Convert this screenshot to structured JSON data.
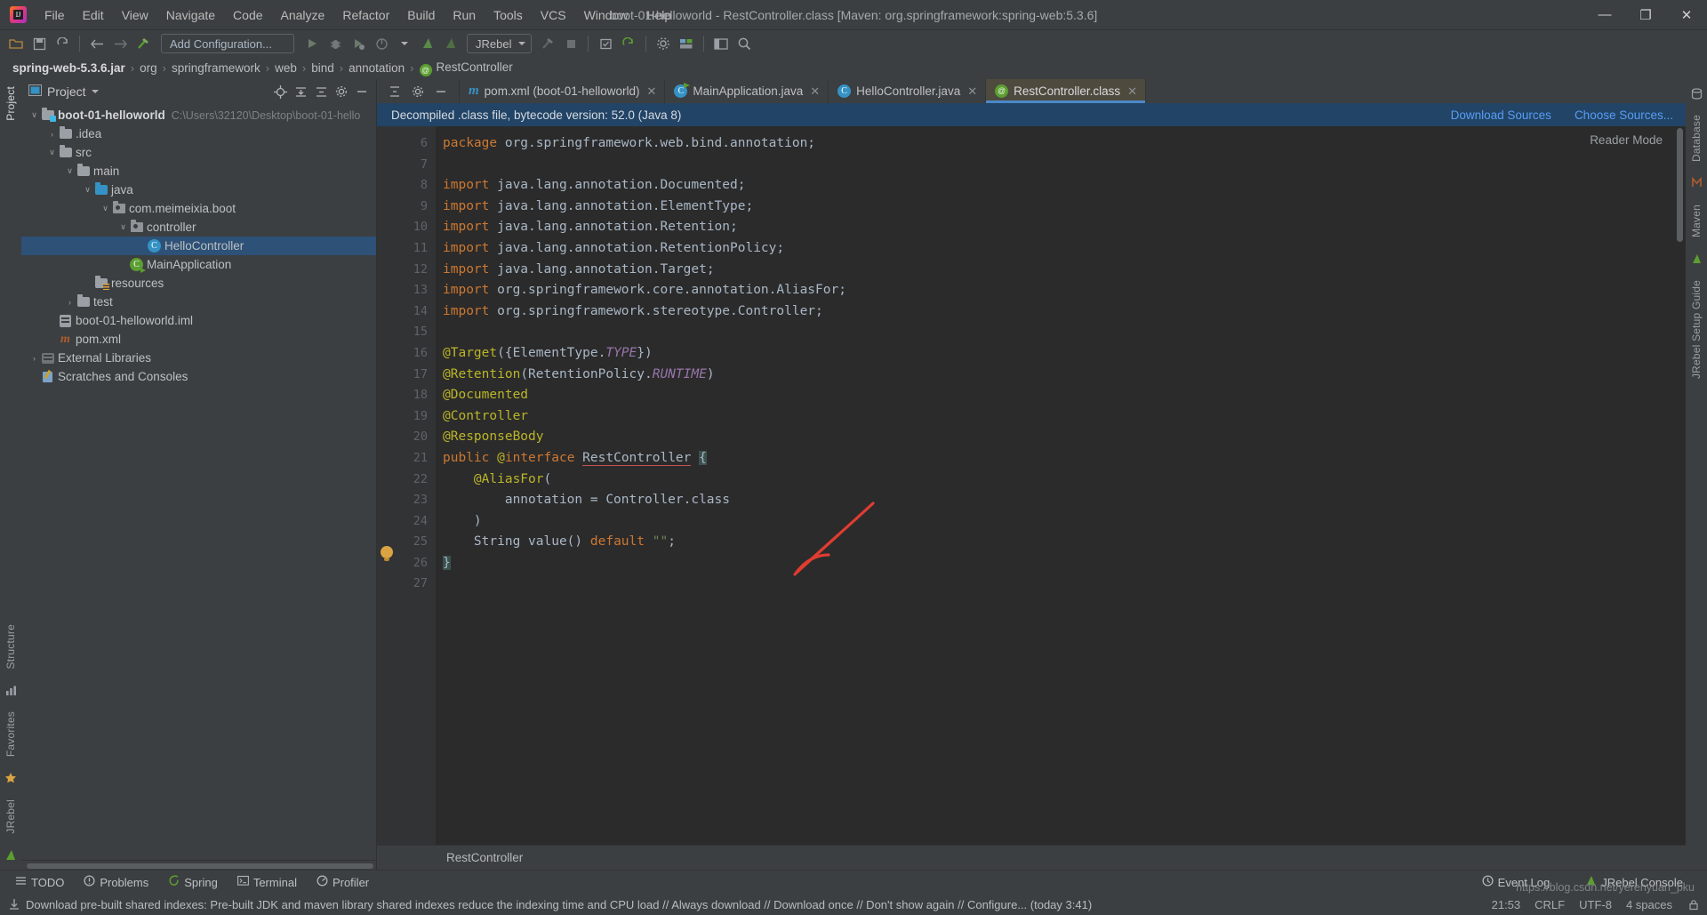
{
  "window": {
    "title": "boot-01-helloworld - RestController.class [Maven: org.springframework:spring-web:5.3.6]",
    "minimize": "—",
    "maximize": "❐",
    "close": "✕"
  },
  "menu": [
    "File",
    "Edit",
    "View",
    "Navigate",
    "Code",
    "Analyze",
    "Refactor",
    "Build",
    "Run",
    "Tools",
    "VCS",
    "Window",
    "Help"
  ],
  "toolbar": {
    "open_icon": "open-folder-icon",
    "save_icon": "save-icon",
    "sync_icon": "sync-icon",
    "back_icon": "back-arrow-icon",
    "forward_icon": "forward-arrow-icon",
    "build_icon": "hammer-icon",
    "run_config": "Add Configuration...",
    "run_icon": "run-icon",
    "debug_icon": "debug-icon",
    "run_coverage_icon": "run-coverage-icon",
    "profile_icon": "profile-icon",
    "jrebel_run_icon": "jrebel-run-icon",
    "jrebel_debug_icon": "jrebel-debug-icon",
    "jrebel_select": "JRebel",
    "stop_icon": "stop-icon",
    "build_project_icon": "build-project-icon",
    "commit_icon": "commit-icon",
    "update_icon": "update-project-icon",
    "settings_icon": "gear-icon",
    "structure_icon": "project-structure-icon",
    "layout_icon": "layout-icon",
    "search_icon": "search-icon"
  },
  "breadcrumb": {
    "items": [
      "spring-web-5.3.6.jar",
      "org",
      "springframework",
      "web",
      "bind",
      "annotation"
    ],
    "leaf": "RestController",
    "separator": "›"
  },
  "project_panel": {
    "title": "Project",
    "dropdown_icon": "chevron-down-icon",
    "actions": [
      "locate-icon",
      "expand-all-icon",
      "collapse-all-icon",
      "settings-icon",
      "hide-icon"
    ],
    "tree": [
      {
        "label": "boot-01-helloworld",
        "path": "C:\\Users\\32120\\Desktop\\boot-01-hello",
        "indent": 0,
        "arrow": "∨",
        "icon": "module-folder",
        "bold": true,
        "selected": false
      },
      {
        "label": ".idea",
        "path": "",
        "indent": 1,
        "arrow": "›",
        "icon": "folder",
        "bold": false,
        "selected": false
      },
      {
        "label": "src",
        "path": "",
        "indent": 1,
        "arrow": "∨",
        "icon": "folder",
        "bold": false,
        "selected": false
      },
      {
        "label": "main",
        "path": "",
        "indent": 2,
        "arrow": "∨",
        "icon": "folder",
        "bold": false,
        "selected": false
      },
      {
        "label": "java",
        "path": "",
        "indent": 3,
        "arrow": "∨",
        "icon": "folder-blue",
        "bold": false,
        "selected": false
      },
      {
        "label": "com.meimeixia.boot",
        "path": "",
        "indent": 4,
        "arrow": "∨",
        "icon": "package",
        "bold": false,
        "selected": false
      },
      {
        "label": "controller",
        "path": "",
        "indent": 5,
        "arrow": "∨",
        "icon": "package",
        "bold": false,
        "selected": false
      },
      {
        "label": "HelloController",
        "path": "",
        "indent": 6,
        "arrow": "",
        "icon": "class",
        "bold": false,
        "selected": true
      },
      {
        "label": "MainApplication",
        "path": "",
        "indent": 5,
        "arrow": "",
        "icon": "spring-class",
        "bold": false,
        "selected": false
      },
      {
        "label": "resources",
        "path": "",
        "indent": 3,
        "arrow": "",
        "icon": "folder-resources",
        "bold": false,
        "selected": false
      },
      {
        "label": "test",
        "path": "",
        "indent": 2,
        "arrow": "›",
        "icon": "folder",
        "bold": false,
        "selected": false
      },
      {
        "label": "boot-01-helloworld.iml",
        "path": "",
        "indent": 1,
        "arrow": "",
        "icon": "iml",
        "bold": false,
        "selected": false
      },
      {
        "label": "pom.xml",
        "path": "",
        "indent": 1,
        "arrow": "",
        "icon": "maven",
        "bold": false,
        "selected": false
      },
      {
        "label": "External Libraries",
        "path": "",
        "indent": 0,
        "arrow": "›",
        "icon": "ext-lib",
        "bold": false,
        "selected": false
      },
      {
        "label": "Scratches and Consoles",
        "path": "",
        "indent": 0,
        "arrow": "",
        "icon": "scratch",
        "bold": false,
        "selected": false
      }
    ]
  },
  "left_rail": {
    "project_tab": "Project",
    "structure_tab": "Structure",
    "favorites_tab": "Favorites",
    "jrebel_tab": "JRebel"
  },
  "right_rail": {
    "database_tab": "Database",
    "maven_tab": "Maven",
    "jrebel_guide_tab": "JRebel Setup Guide"
  },
  "editor_tabs": [
    {
      "label": "pom.xml (boot-01-helloworld)",
      "icon": "maven-icon",
      "active": false,
      "close": "✕"
    },
    {
      "label": "MainApplication.java",
      "icon": "spring-boot-class-icon",
      "active": false,
      "close": "✕"
    },
    {
      "label": "HelloController.java",
      "icon": "java-class-icon",
      "active": false,
      "close": "✕"
    },
    {
      "label": "RestController.class",
      "icon": "annotation-icon",
      "active": true,
      "close": "✕"
    }
  ],
  "banner": {
    "message": "Decompiled .class file, bytecode version: 52.0 (Java 8)",
    "download_sources": "Download Sources",
    "choose_sources": "Choose Sources..."
  },
  "editor": {
    "reader_mode": "Reader Mode",
    "line_numbers": [
      6,
      7,
      8,
      9,
      10,
      11,
      12,
      13,
      14,
      15,
      16,
      17,
      18,
      19,
      20,
      21,
      22,
      23,
      24,
      25,
      26,
      27
    ],
    "lines": [
      "package org.springframework.web.bind.annotation;",
      "",
      "import java.lang.annotation.Documented;",
      "import java.lang.annotation.ElementType;",
      "import java.lang.annotation.Retention;",
      "import java.lang.annotation.RetentionPolicy;",
      "import java.lang.annotation.Target;",
      "import org.springframework.core.annotation.AliasFor;",
      "import org.springframework.stereotype.Controller;",
      "",
      "@Target({ElementType.TYPE})",
      "@Retention(RetentionPolicy.RUNTIME)",
      "@Documented",
      "@Controller",
      "@ResponseBody",
      "public @interface RestController {",
      "    @AliasFor(",
      "        annotation = Controller.class",
      "    )",
      "    String value() default \"\";",
      "}",
      ""
    ],
    "status_label": "RestController"
  },
  "bottom_bar": {
    "items": [
      {
        "label": "TODO",
        "icon": "todo-icon"
      },
      {
        "label": "Problems",
        "icon": "problems-icon"
      },
      {
        "label": "Spring",
        "icon": "spring-icon"
      },
      {
        "label": "Terminal",
        "icon": "terminal-icon"
      },
      {
        "label": "Profiler",
        "icon": "profiler-icon"
      }
    ],
    "event_log": "Event Log",
    "jrebel_console": "JRebel Console"
  },
  "status_bar": {
    "download_icon": "download-icon",
    "message": "Download pre-built shared indexes: Pre-built JDK and maven library shared indexes reduce the indexing time and CPU load // Always download // Download once // Don't show again // Configure... (today 3:41)",
    "position": "21:53",
    "line_sep": "CRLF",
    "encoding": "UTF-8",
    "indent": "4 spaces",
    "lock_icon": "lock-icon"
  },
  "watermark": "https://blog.csdn.net/yerenyuan_pku",
  "colors": {
    "accent": "#4a88c7",
    "banner_bg": "#224466",
    "selection": "#2d5177",
    "annotation": "#bbb529",
    "keyword": "#cc7832",
    "string": "#6a8759",
    "arrow_red": "#e03c31"
  }
}
